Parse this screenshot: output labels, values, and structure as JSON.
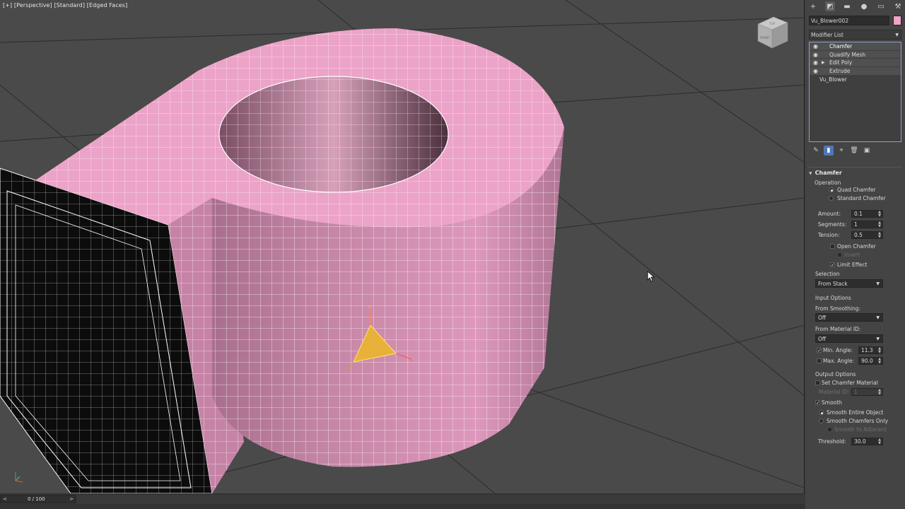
{
  "viewport": {
    "label_plus": "[+]",
    "label_view": "[Perspective]",
    "label_shading": "[Standard]",
    "label_display": "[Edged Faces]",
    "viewcube_top": "TOP",
    "viewcube_front": "FRONT",
    "object_color": "#e99cc5",
    "wire_color": "#ffffff",
    "background_color": "#4a4a4a"
  },
  "command_panel": {
    "tabs": [
      "create-icon",
      "modify-icon",
      "hierarchy-icon",
      "motion-icon",
      "display-icon",
      "utilities-icon"
    ],
    "object_name": "Vu_Blower002",
    "object_color": "#f3a3c8",
    "modifier_list_label": "Modifier List",
    "stack": [
      {
        "name": "Chamfer",
        "selected": true,
        "expand": false
      },
      {
        "name": "Quadify Mesh",
        "selected": false,
        "expand": false
      },
      {
        "name": "Edit Poly",
        "selected": false,
        "expand": true
      },
      {
        "name": "Extrude",
        "selected": false,
        "expand": false
      }
    ],
    "base_object": "Vu_Blower"
  },
  "chamfer": {
    "title": "Chamfer",
    "operation_label": "Operation",
    "quad_chamfer": "Quad Chamfer",
    "standard_chamfer": "Standard Chamfer",
    "amount_label": "Amount:",
    "amount_value": "0.1",
    "segments_label": "Segments:",
    "segments_value": "1",
    "tension_label": "Tension:",
    "tension_value": "0.5",
    "open_chamfer": "Open Chamfer",
    "invert": "Invert",
    "limit_effect": "Limit Effect",
    "selection_label": "Selection",
    "selection_value": "From Stack",
    "input_options_label": "Input Options",
    "from_smoothing_label": "From Smoothing:",
    "from_smoothing_value": "Off",
    "from_material_label": "From Material ID:",
    "from_material_value": "Off",
    "min_angle_label": "Min. Angle:",
    "min_angle_value": "11.3",
    "max_angle_label": "Max. Angle:",
    "max_angle_value": "90.0",
    "output_options_label": "Output Options",
    "set_chamfer_material": "Set Chamfer Material",
    "material_id_label": "Material ID:",
    "material_id_value": "1",
    "smooth": "Smooth",
    "smooth_entire": "Smooth Entire Object",
    "smooth_chamfers": "Smooth Chamfers Only",
    "smooth_adjacent": "Smooth to Adjacent",
    "threshold_label": "Threshold:",
    "threshold_value": "30.0"
  },
  "timeline": {
    "frame": "0 / 100",
    "prev": "<",
    "next": ">"
  }
}
